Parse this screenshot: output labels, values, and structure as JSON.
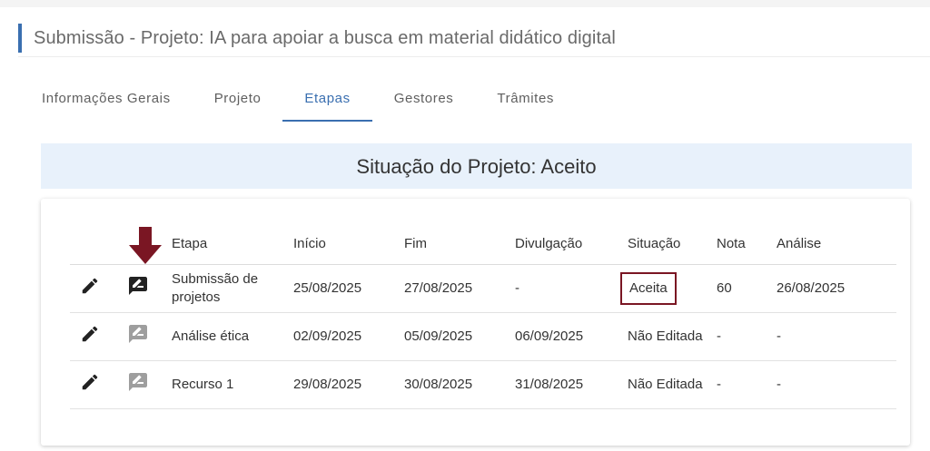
{
  "window_title": "Submissão - Projeto: IA para apoiar a busca em material didático digital",
  "tabs": [
    {
      "label": "Informações Gerais",
      "active": false
    },
    {
      "label": "Projeto",
      "active": false
    },
    {
      "label": "Etapas",
      "active": true
    },
    {
      "label": "Gestores",
      "active": false
    },
    {
      "label": "Trâmites",
      "active": false
    }
  ],
  "status_banner": "Situação do Projeto: Aceito",
  "table": {
    "headers": {
      "etapa": "Etapa",
      "inicio": "Início",
      "fim": "Fim",
      "divulgacao": "Divulgação",
      "situacao": "Situação",
      "nota": "Nota",
      "analise": "Análise"
    },
    "rows": [
      {
        "etapa": "Submissão de projetos",
        "inicio": "25/08/2025",
        "fim": "27/08/2025",
        "divulgacao": "-",
        "situacao": "Aceita",
        "nota": "60",
        "analise": "26/08/2025",
        "evaluate_enabled": true,
        "highlighted": true
      },
      {
        "etapa": "Análise ética",
        "inicio": "02/09/2025",
        "fim": "05/09/2025",
        "divulgacao": "06/09/2025",
        "situacao": "Não Editada",
        "nota": "-",
        "analise": "-",
        "evaluate_enabled": false,
        "highlighted": false
      },
      {
        "etapa": "Recurso 1",
        "inicio": "29/08/2025",
        "fim": "30/08/2025",
        "divulgacao": "31/08/2025",
        "situacao": "Não Editada",
        "nota": "-",
        "analise": "-",
        "evaluate_enabled": false,
        "highlighted": false
      }
    ]
  },
  "icons": {
    "edit": "pencil-icon",
    "evaluate": "rate-review-icon",
    "marker": "down-arrow-marker"
  },
  "colors": {
    "accent": "#3a6fb0",
    "banner_bg": "#e8f1fb",
    "highlight_border": "#7a1623",
    "marker_arrow": "#7a1623",
    "icon_enabled": "#222222",
    "icon_disabled": "#9e9e9e"
  }
}
